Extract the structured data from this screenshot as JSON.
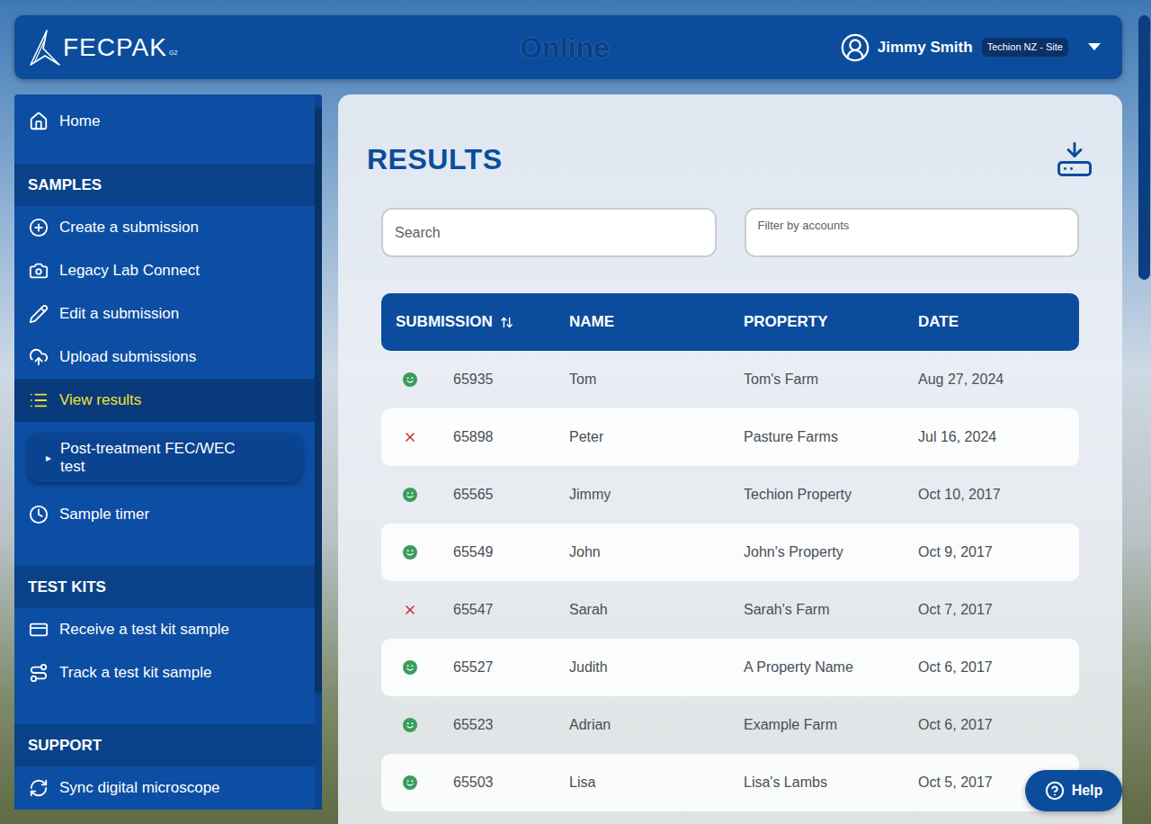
{
  "header": {
    "logo": {
      "text": "FECPAK",
      "superscript": "G2"
    },
    "title": "Online",
    "user": {
      "name": "Jimmy Smith",
      "badge": "Techion NZ - Site"
    }
  },
  "sidebar": {
    "top_items": [
      {
        "label": "Home",
        "selected": false
      }
    ],
    "sections": [
      {
        "heading": "SAMPLES",
        "items": [
          {
            "kind": "link",
            "label": "Create a submission",
            "selected": false
          },
          {
            "kind": "link",
            "label": "Legacy Lab Connect",
            "selected": false
          },
          {
            "kind": "link",
            "label": "Edit a submission",
            "selected": false
          },
          {
            "kind": "link",
            "label": "Upload submissions",
            "selected": false
          },
          {
            "kind": "link",
            "label": "View results",
            "selected": true
          },
          {
            "kind": "subitem",
            "marker": "▸",
            "label": "Post-treatment FEC/WEC test",
            "selected": false
          },
          {
            "kind": "link",
            "label": "Sample timer",
            "selected": false
          }
        ]
      },
      {
        "heading": "TEST KITS",
        "items": [
          {
            "kind": "link",
            "label": "Receive a test kit sample",
            "selected": false
          },
          {
            "kind": "link",
            "label": "Track a test kit sample",
            "selected": false
          }
        ]
      },
      {
        "heading": "SUPPORT",
        "items": [
          {
            "kind": "link",
            "label": "Sync digital microscope",
            "selected": false
          }
        ]
      }
    ]
  },
  "main": {
    "title": "RESULTS",
    "search": {
      "placeholder": "Search"
    },
    "filter": {
      "label": "Filter by accounts"
    },
    "table": {
      "columns": [
        {
          "label": "SUBMISSION",
          "sortable": true
        },
        {
          "label": "NAME",
          "sortable": false
        },
        {
          "label": "PROPERTY",
          "sortable": false
        },
        {
          "label": "DATE",
          "sortable": false
        }
      ],
      "rows": [
        {
          "kind": "pass",
          "color": "#3a9d5d",
          "submission": "65935",
          "name": "Tom",
          "property": "Tom's Farm",
          "date": "Aug 27, 2024"
        },
        {
          "kind": "fail",
          "color": "#d42a2a",
          "submission": "65898",
          "name": "Peter",
          "property": "Pasture Farms",
          "date": "Jul 16, 2024"
        },
        {
          "kind": "pass",
          "color": "#3a9d5d",
          "submission": "65565",
          "name": "Jimmy",
          "property": "Techion Property",
          "date": "Oct 10, 2017"
        },
        {
          "kind": "pass",
          "color": "#3a9d5d",
          "submission": "65549",
          "name": "John",
          "property": "John's Property",
          "date": "Oct 9, 2017"
        },
        {
          "kind": "fail",
          "color": "#d42a2a",
          "submission": "65547",
          "name": "Sarah",
          "property": "Sarah's Farm",
          "date": "Oct 7, 2017"
        },
        {
          "kind": "pass",
          "color": "#3a9d5d",
          "submission": "65527",
          "name": "Judith",
          "property": "A Property Name",
          "date": "Oct 6, 2017"
        },
        {
          "kind": "pass",
          "color": "#3a9d5d",
          "submission": "65523",
          "name": "Adrian",
          "property": "Example Farm",
          "date": "Oct 6, 2017"
        },
        {
          "kind": "pass",
          "color": "#3a9d5d",
          "submission": "65503",
          "name": "Lisa",
          "property": "Lisa's Lambs",
          "date": "Oct 5, 2017"
        }
      ]
    }
  },
  "help_button": {
    "label": "Help"
  }
}
